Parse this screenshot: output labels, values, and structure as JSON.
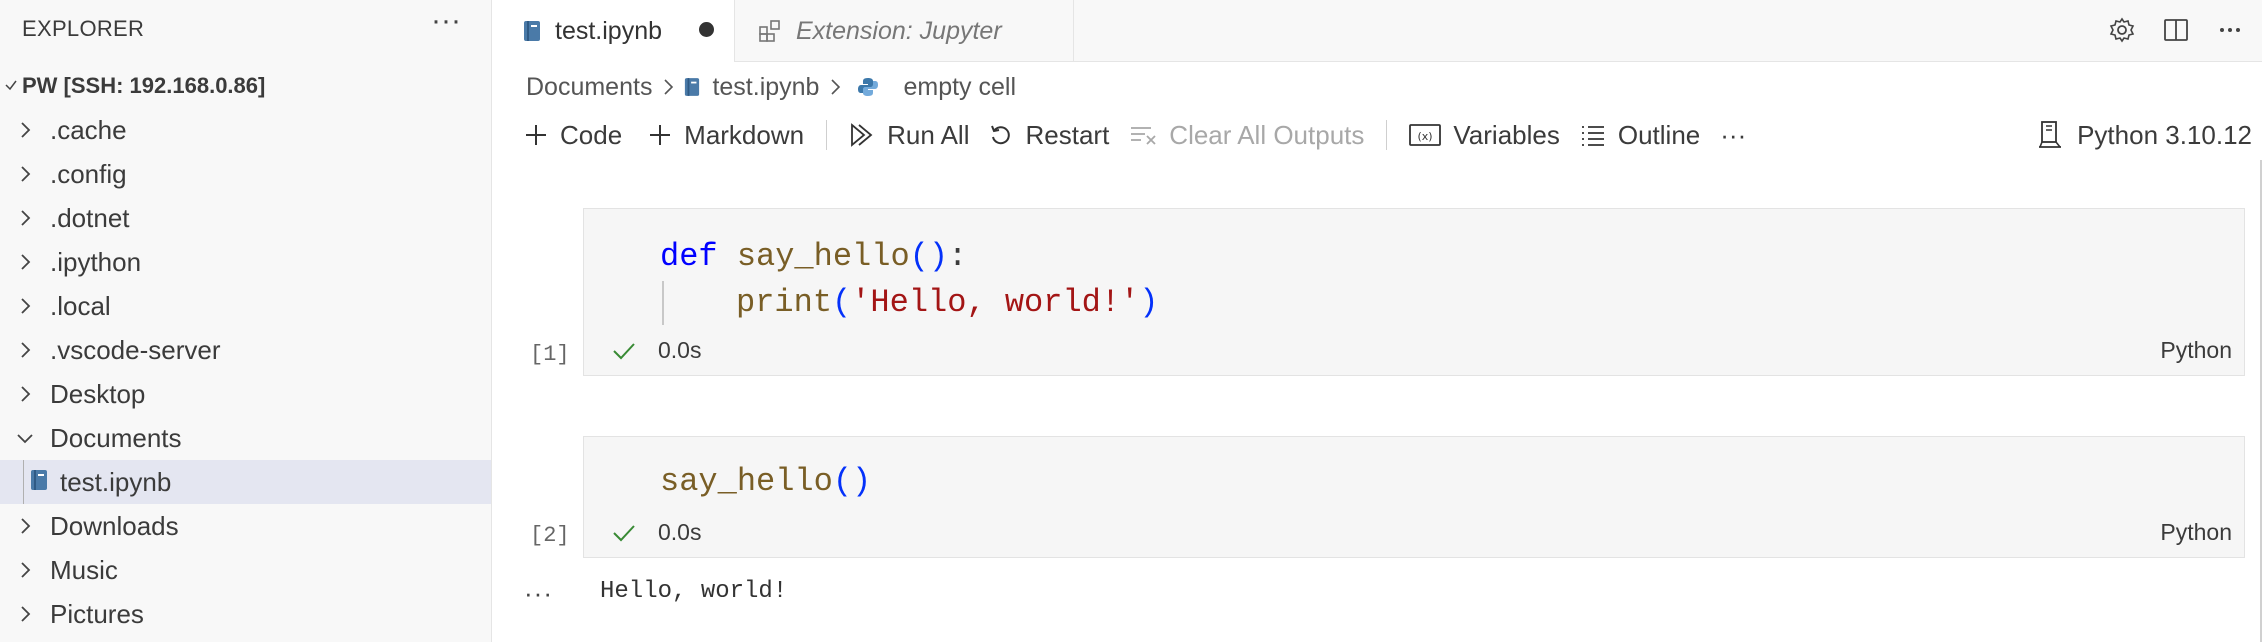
{
  "explorer": {
    "title": "EXPLORER",
    "more_label": "···",
    "root_label": "PW [SSH: 192.168.0.86]",
    "items": [
      {
        "label": ".cache",
        "type": "folder",
        "expanded": false
      },
      {
        "label": ".config",
        "type": "folder",
        "expanded": false
      },
      {
        "label": ".dotnet",
        "type": "folder",
        "expanded": false
      },
      {
        "label": ".ipython",
        "type": "folder",
        "expanded": false
      },
      {
        "label": ".local",
        "type": "folder",
        "expanded": false
      },
      {
        "label": ".vscode-server",
        "type": "folder",
        "expanded": false
      },
      {
        "label": "Desktop",
        "type": "folder",
        "expanded": false
      },
      {
        "label": "Documents",
        "type": "folder",
        "expanded": true
      },
      {
        "label": "test.ipynb",
        "type": "notebook-file",
        "selected": true
      },
      {
        "label": "Downloads",
        "type": "folder",
        "expanded": false
      },
      {
        "label": "Music",
        "type": "folder",
        "expanded": false
      },
      {
        "label": "Pictures",
        "type": "folder",
        "expanded": false
      }
    ]
  },
  "tabs": [
    {
      "label": "test.ipynb",
      "active": true,
      "dirty": true,
      "icon": "notebook-icon"
    },
    {
      "label": "Extension: Jupyter",
      "active": false,
      "preview": true,
      "icon": "extensions-icon"
    }
  ],
  "tab_actions": [
    "gear-icon",
    "split-editor-icon",
    "more-icon"
  ],
  "breadcrumb": [
    "Documents",
    "test.ipynb",
    "empty cell"
  ],
  "toolbar": {
    "code": "Code",
    "markdown": "Markdown",
    "run_all": "Run All",
    "restart": "Restart",
    "clear_all_outputs": "Clear All Outputs",
    "variables": "Variables",
    "outline": "Outline",
    "more": "···",
    "kernel": "Python 3.10.12"
  },
  "cells": [
    {
      "exec_count": "[1]",
      "status_time": "0.0s",
      "language": "Python",
      "code": {
        "kw": "def",
        "fn": "say_hello",
        "paren1": "()",
        "colon": ":",
        "print": "print",
        "open": "(",
        "str": "'Hello, world!'",
        "close": ")"
      }
    },
    {
      "exec_count": "[2]",
      "status_time": "0.0s",
      "language": "Python",
      "code": {
        "fn": "say_hello",
        "paren": "()"
      },
      "output_more": "···",
      "output": "Hello, world!"
    }
  ],
  "colors": {
    "keyword": "#0000ff",
    "function": "#795e26",
    "string": "#a31515",
    "paren": "#0431fa",
    "success": "#388a34",
    "selection": "#e4e6f1"
  }
}
